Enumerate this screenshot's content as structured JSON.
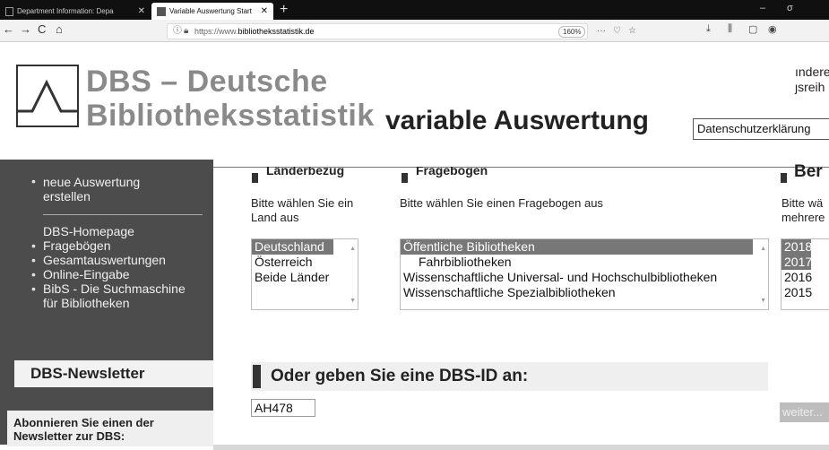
{
  "browser": {
    "tabs": [
      {
        "label": "Department Information: Depa"
      },
      {
        "label": "Variable Auswertung Start"
      }
    ],
    "url_prefix": "https://www.",
    "url_domain": "bibliotheksstatistik.de",
    "zoom": "160%",
    "nav": {
      "back": "←",
      "forward": "→",
      "reload": "C",
      "home": "⌂"
    },
    "win": {
      "minimize": "–",
      "maximize": "σ"
    }
  },
  "header": {
    "brand_line1": "DBS – Deutsche",
    "brand_line2": "Bibliotheksstatistik",
    "page_title": "variable Auswertung",
    "privacy_link": "Datenschutzerklärung",
    "clipped_line1": "ındere",
    "clipped_line2": "ȷsreih"
  },
  "sidebar": {
    "new_eval_line1": "neue Auswertung",
    "new_eval_line2": "erstellen",
    "links": [
      {
        "label": "DBS-Homepage"
      },
      {
        "label": "Fragebögen"
      },
      {
        "label": "Gesamtauswertungen"
      },
      {
        "label": "Online-Eingabe"
      },
      {
        "label": "BibS - Die Suchmaschine"
      },
      {
        "label": "für Bibliotheken"
      }
    ],
    "newsletter_title": "DBS-Newsletter",
    "subscribe_line1": "Abonnieren Sie einen der",
    "subscribe_line2": "Newsletter zur DBS:"
  },
  "sections": {
    "country": {
      "heading": "Länderbezug",
      "desc_line1": "Bitte wählen Sie ein",
      "desc_line2": "Land aus",
      "options": [
        "Deutschland",
        "Österreich",
        "Beide Länder"
      ],
      "selected": "Deutschland"
    },
    "questionnaire": {
      "heading": "Fragebogen",
      "desc": "Bitte wählen Sie einen Fragebogen aus",
      "options": [
        "Öffentliche Bibliotheken",
        "Fahrbibliotheken",
        "Wissenschaftliche Universal- und Hochschulbibliotheken",
        "Wissenschaftliche Spezialbibliotheken"
      ],
      "selected": "Öffentliche Bibliotheken"
    },
    "report": {
      "heading": "Ber",
      "desc_line1": "Bitte wä",
      "desc_line2": "mehrere",
      "options": [
        "2018",
        "2017",
        "2016",
        "2015"
      ],
      "selected": [
        "2018",
        "2017"
      ]
    }
  },
  "dbs_id": {
    "heading": "Oder geben Sie eine DBS-ID an:",
    "value": "AH478"
  },
  "weiter_button": "weiter..."
}
